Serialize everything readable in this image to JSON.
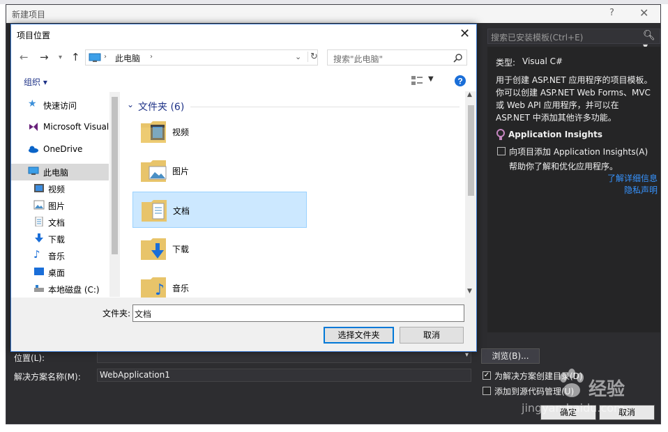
{
  "vs_dialog": {
    "title": "新建项目",
    "help": "?",
    "close": "✕",
    "search_placeholder": "搜索已安装模板(Ctrl+E)",
    "type_label": "类型:",
    "type_value": "Visual C#",
    "description_lines": [
      "用于创建 ASP.NET 应用程序的项目模板。",
      "你可以创建 ASP.NET Web Forms、MVC",
      "或 Web API 应用程序，并可以在",
      "ASP.NET 中添加其他许多功能。"
    ],
    "insights_title": "Application Insights",
    "insights_checkbox_label": "向项目添加 Application Insights(A)",
    "insights_desc": "帮助你了解和优化应用程序。",
    "learn_more_link": "了解详细信息",
    "privacy_link": "隐私声明",
    "location_label": "位置(L):",
    "solution_name_label": "解决方案名称(M):",
    "solution_name_value": "WebApplication1",
    "browse_button": "浏览(B)...",
    "create_dir_label": "为解决方案创建目录(D)",
    "add_source_label": "添加到源代码管理(U)",
    "ok_button": "确定",
    "cancel_button": "取消"
  },
  "picker": {
    "title": "项目位置",
    "close": "✕",
    "breadcrumb": "此电脑",
    "search_placeholder": "搜索\"此电脑\"",
    "organize": "组织 ▾",
    "nav_items": [
      {
        "label": "快速访问",
        "icon": "star-icon"
      },
      {
        "label": "Microsoft Visual",
        "icon": "visual-studio-icon"
      },
      {
        "label": "OneDrive",
        "icon": "onedrive-icon"
      },
      {
        "label": "此电脑",
        "icon": "computer-icon"
      },
      {
        "label": "视频",
        "icon": "videos-icon"
      },
      {
        "label": "图片",
        "icon": "pictures-icon"
      },
      {
        "label": "文档",
        "icon": "documents-icon"
      },
      {
        "label": "下载",
        "icon": "downloads-icon"
      },
      {
        "label": "音乐",
        "icon": "music-icon"
      },
      {
        "label": "桌面",
        "icon": "desktop-icon"
      },
      {
        "label": "本地磁盘 (C:)",
        "icon": "drive-icon"
      }
    ],
    "group_header": "文件夹 (6)",
    "folders": [
      "视频",
      "图片",
      "文档",
      "下载",
      "音乐"
    ],
    "selected_folder": "文档",
    "folder_field_label": "文件夹:",
    "folder_field_value": "文档",
    "select_button": "选择文件夹",
    "cancel_button": "取消"
  },
  "watermark": {
    "brand": "经验",
    "url": "jingyan.baidu.com"
  },
  "colors": {
    "vs_dark": "#2d2d30",
    "link": "#3794ff",
    "selection": "#cce8ff",
    "accent": "#0078d7"
  }
}
